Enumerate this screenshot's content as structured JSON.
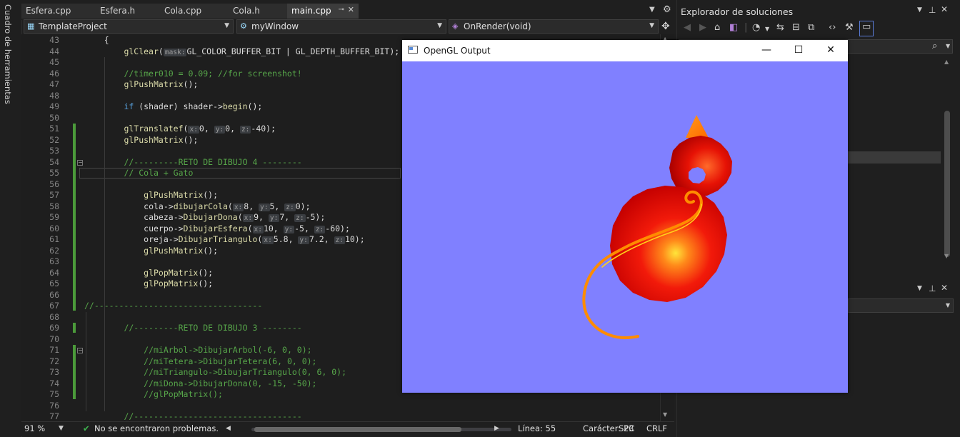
{
  "toolbox": {
    "label": "Cuadro de herramientas"
  },
  "tabs": [
    {
      "label": "Esfera.cpp"
    },
    {
      "label": "Esfera.h"
    },
    {
      "label": "Cola.cpp"
    },
    {
      "label": "Cola.h"
    },
    {
      "label": "main.cpp",
      "pin_icon": "pin-icon",
      "close_icon": "close-icon"
    }
  ],
  "navbar": {
    "project": "TemplateProject",
    "scope": "myWindow",
    "member": "OnRender(void)"
  },
  "editor": {
    "lines": [
      {
        "n": "43",
        "code": "{"
      },
      {
        "n": "44",
        "code": "glClear(mask:GL_COLOR_BUFFER_BIT | GL_DEPTH_BUFFER_BIT);"
      },
      {
        "n": "45",
        "code": ""
      },
      {
        "n": "46",
        "code": "//timer010 = 0.09; //for screenshot!"
      },
      {
        "n": "47",
        "code": "glPushMatrix();"
      },
      {
        "n": "48",
        "code": ""
      },
      {
        "n": "49",
        "code": "if (shader) shader->begin();"
      },
      {
        "n": "50",
        "code": ""
      },
      {
        "n": "51",
        "code": "glTranslatef(x:0, y:0, z:-40);"
      },
      {
        "n": "52",
        "code": "glPushMatrix();"
      },
      {
        "n": "53",
        "code": ""
      },
      {
        "n": "54",
        "code": "//---------RETO DE DIBUJO 4 --------"
      },
      {
        "n": "55",
        "code": "// Cola + Gato"
      },
      {
        "n": "56",
        "code": ""
      },
      {
        "n": "57",
        "code": "glPushMatrix();"
      },
      {
        "n": "58",
        "code": "cola->dibujarCola(x:8, y:5, z:0);"
      },
      {
        "n": "59",
        "code": "cabeza->DibujarDona(x:9, y:7, z:-5);"
      },
      {
        "n": "60",
        "code": "cuerpo->DibujarEsfera(x:10, y:-5, z:-60);"
      },
      {
        "n": "61",
        "code": "oreja->DibujarTriangulo(x:5.8, y:7.2, z:10);"
      },
      {
        "n": "62",
        "code": "glPushMatrix();"
      },
      {
        "n": "63",
        "code": ""
      },
      {
        "n": "64",
        "code": "glPopMatrix();"
      },
      {
        "n": "65",
        "code": "glPopMatrix();"
      },
      {
        "n": "66",
        "code": ""
      },
      {
        "n": "67",
        "code": "//----------------------------------"
      },
      {
        "n": "68",
        "code": ""
      },
      {
        "n": "69",
        "code": "//---------RETO DE DIBUJO 3 --------"
      },
      {
        "n": "70",
        "code": ""
      },
      {
        "n": "71",
        "code": "//miArbol->DibujarArbol(-6, 0, 0);"
      },
      {
        "n": "72",
        "code": "//miTetera->DibujarTetera(6, 0, 0);"
      },
      {
        "n": "73",
        "code": "//miTriangulo->DibujarTriangulo(0, 6, 0);"
      },
      {
        "n": "74",
        "code": "//miDona->DibujarDona(0, -15, -50);"
      },
      {
        "n": "75",
        "code": "//glPopMatrix();"
      },
      {
        "n": "76",
        "code": ""
      },
      {
        "n": "77",
        "code": "//----------------------------------"
      }
    ]
  },
  "status": {
    "zoom": "91 %",
    "problems": "No se encontraron problemas.",
    "line": "Línea: 55",
    "char": "Carácter: 23",
    "spc": "SPC",
    "eol": "CRLF"
  },
  "solution_explorer": {
    "title": "Explorador de soluciones"
  },
  "gl_window": {
    "title": "OpenGL Output",
    "background": "#8080ff"
  },
  "colors": {
    "accent": "#3fb950",
    "change_bar": "#4b9a3a"
  }
}
